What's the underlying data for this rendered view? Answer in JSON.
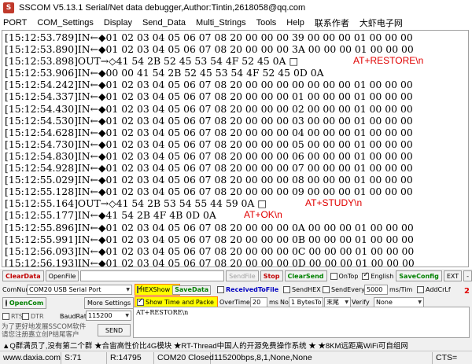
{
  "window": {
    "title": "SSCOM V5.13.1 Serial/Net data debugger,Author:Tintin,2618058@qq.com",
    "icon_text": "S"
  },
  "menu": [
    "PORT",
    "COM_Settings",
    "Display",
    "Send_Data",
    "Multi_Strings",
    "Tools",
    "Help",
    "联系作者",
    "大虾电子网"
  ],
  "log": {
    "lines": [
      {
        "text": "[15:12:53.789]IN←◆01 02 03 04 05 06 07 08 20 00 00 00 39 00 00 00 01 00 00 00",
        "note": ""
      },
      {
        "text": "[15:12:53.890]IN←◆01 02 03 04 05 06 07 08 20 00 00 00 3A 00 00 00 01 00 00 00",
        "note": ""
      },
      {
        "text": "[15:12:53.898]OUT→◇41 54 2B 52 45 53 54 4F 52 45 0A □",
        "note": "AT+RESTORE\\n"
      },
      {
        "text": "[15:12:53.906]IN←◆00 00 41 54 2B 52 45 53 54 4F 52 45 0D 0A",
        "note": ""
      },
      {
        "text": "[15:12:54.242]IN←◆01 02 03 04 05 06 07 08 20 00 00 00 00 00 00 00 01 00 00 00",
        "note": ""
      },
      {
        "text": "[15:12:54.337]IN←◆01 02 03 04 05 06 07 08 20 00 00 00 01 00 00 00 01 00 00 00",
        "note": ""
      },
      {
        "text": "[15:12:54.430]IN←◆01 02 03 04 05 06 07 08 20 00 00 00 02 00 00 00 01 00 00 00",
        "note": ""
      },
      {
        "text": "[15:12:54.530]IN←◆01 02 03 04 05 06 07 08 20 00 00 00 03 00 00 00 01 00 00 00",
        "note": ""
      },
      {
        "text": "[15:12:54.628]IN←◆01 02 03 04 05 06 07 08 20 00 00 00 04 00 00 00 01 00 00 00",
        "note": ""
      },
      {
        "text": "[15:12:54.730]IN←◆01 02 03 04 05 06 07 08 20 00 00 00 05 00 00 00 01 00 00 00",
        "note": ""
      },
      {
        "text": "[15:12:54.830]IN←◆01 02 03 04 05 06 07 08 20 00 00 00 06 00 00 00 01 00 00 00",
        "note": ""
      },
      {
        "text": "[15:12:54.928]IN←◆01 02 03 04 05 06 07 08 20 00 00 00 07 00 00 00 01 00 00 00",
        "note": ""
      },
      {
        "text": "[15:12:55.029]IN←◆01 02 03 04 05 06 07 08 20 00 00 00 08 00 00 00 01 00 00 00",
        "note": ""
      },
      {
        "text": "[15:12:55.128]IN←◆01 02 03 04 05 06 07 08 20 00 00 00 09 00 00 00 01 00 00 00",
        "note": ""
      },
      {
        "text": "[15:12:55.164]OUT→◇41 54 2B 53 54 55 44 59 0A □",
        "note": "AT+STUDY\\n"
      },
      {
        "text": "[15:12:55.177]IN←◆41 54 2B 4F 4B 0D 0A",
        "note": "AT+OK\\n"
      },
      {
        "text": "[15:12:55.896]IN←◆01 02 03 04 05 06 07 08 20 00 00 00 0A 00 00 00 01 00 00 00",
        "note": ""
      },
      {
        "text": "[15:12:55.991]IN←◆01 02 03 04 05 06 07 08 20 00 00 00 0B 00 00 00 01 00 00 00",
        "note": ""
      },
      {
        "text": "[15:12:56.093]IN←◆01 02 03 04 05 06 07 08 20 00 00 00 0C 00 00 00 01 00 00 00",
        "note": ""
      },
      {
        "text": "[15:12:56.193]IN←◆01 02 03 04 05 06 07 08 20 00 00 00 0D 00 00 00 01 00 00 00",
        "note": ""
      }
    ]
  },
  "toolbar": {
    "clear_data": "ClearData",
    "open_file": "OpenFile",
    "send_file": "SendFile",
    "stop": "Stop",
    "clear_send": "ClearSend",
    "on_top": "OnTop",
    "english": "English",
    "save_config": "SaveConfig",
    "ext": "EXT",
    "minus": "-"
  },
  "controls": {
    "com_num_label": "ComNum",
    "com_port": "COM20 USB Serial Port",
    "open_com": "OpenCom",
    "more_settings": "More Settings",
    "rts": "RTS",
    "dtr": "DTR",
    "baud_label": "BaudRat",
    "baud": "115200",
    "hex_show": "HEXShow",
    "save_data": "SaveData",
    "received_to_file": "ReceivedToFile",
    "send_hex": "SendHEX",
    "send_every": "SendEvery",
    "send_every_value": "5000",
    "send_every_unit": "ms/Tim",
    "add_crlf": "AddCrLf",
    "show_time": "Show Time and Packe",
    "overtime_label": "OverTime",
    "overtime_value": "20",
    "ms_label": "ms",
    "no_label": "No",
    "bytes_to": "1 BytesTo",
    "tail": "末尾",
    "verify_label": "Verify",
    "verify": "None",
    "send_text": "AT+RESTORE\\n",
    "send_button": "SEND",
    "promo_line1": "为了更好地发展SSCOM软件",
    "promo_line2": "请您注册嘉立创P结尾客户",
    "marker": "2"
  },
  "news": "▲Q群满员了,没有第二个群 ★合宙高性价比4G模块 ★RT-Thread中国人的开源免费操作系统 ★ ★8KM远距离WiFi可自组网",
  "status": {
    "website": "www.daxia.com",
    "sent": "S:71",
    "received": "R:14795",
    "port_state": "COM20 Closed",
    "settings": "115200bps,8,1,None,None",
    "cts": "CTS="
  },
  "colors": {
    "note_red": "#e00000",
    "log_bg": "#ffffff",
    "panel_bg": "#f0f0f0",
    "highlight": "#ffff00"
  }
}
